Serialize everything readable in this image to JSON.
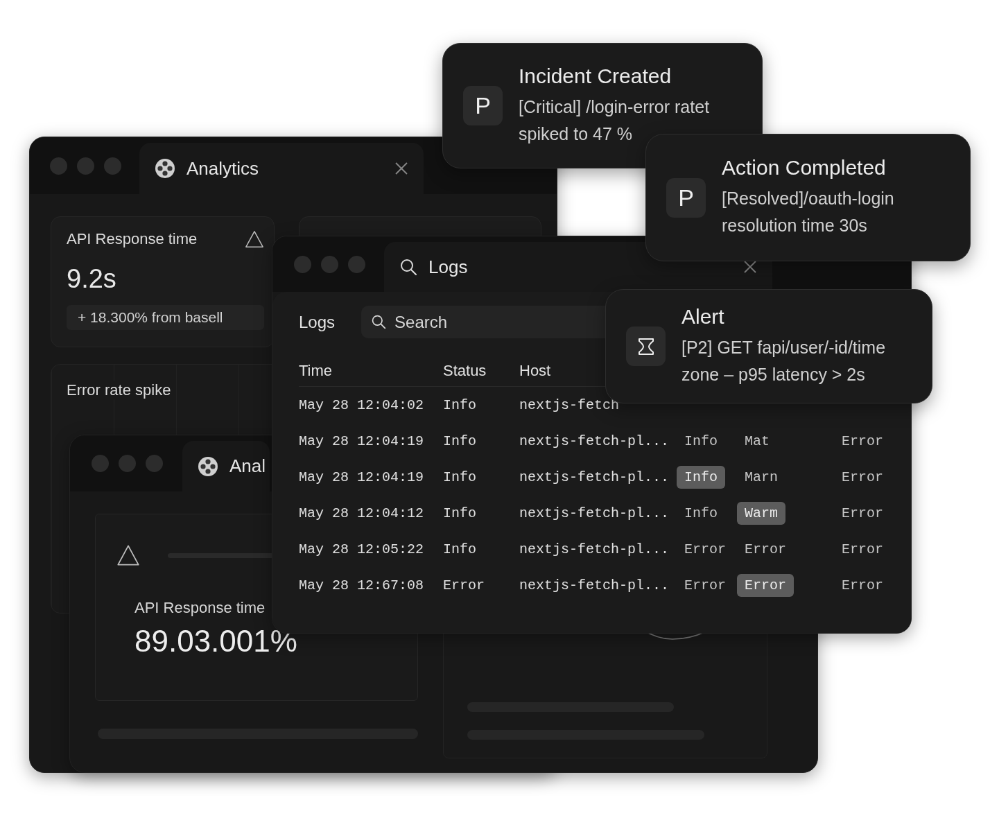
{
  "analytics_window": {
    "tab": {
      "title": "Analytics"
    },
    "metric_card": {
      "title": "API Response time",
      "value": "9.2s",
      "delta": "+ 18.300% from basell"
    },
    "chart_card": {
      "title": "Error rate spike"
    }
  },
  "inner_window": {
    "tab": {
      "title": "Anal"
    },
    "metric_card": {
      "title": "API Response time",
      "value": "89.03.001%"
    }
  },
  "logs_window": {
    "tab": {
      "title": "Logs"
    },
    "heading": "Logs",
    "search": {
      "placeholder": "Search"
    },
    "columns": [
      "Time",
      "Status",
      "Host"
    ],
    "rows": [
      {
        "time": "May 28 12:04:02",
        "status": "Info",
        "host": "nextjs-fetch",
        "cells": []
      },
      {
        "time": "May 28 12:04:19",
        "status": "Info",
        "host": "nextjs-fetch-pl...",
        "cells": [
          {
            "text": "Info",
            "highlighted": false
          },
          {
            "text": "Mat",
            "highlighted": false
          },
          {
            "text": "Error",
            "highlighted": false
          }
        ]
      },
      {
        "time": "May 28 12:04:19",
        "status": "Info",
        "host": "nextjs-fetch-pl...",
        "cells": [
          {
            "text": "Info",
            "highlighted": true
          },
          {
            "text": "Marn",
            "highlighted": false
          },
          {
            "text": "Error",
            "highlighted": false
          }
        ]
      },
      {
        "time": "May 28 12:04:12",
        "status": "Info",
        "host": "nextjs-fetch-pl...",
        "cells": [
          {
            "text": "Info",
            "highlighted": false
          },
          {
            "text": "Warm",
            "highlighted": true
          },
          {
            "text": "Error",
            "highlighted": false
          }
        ]
      },
      {
        "time": "May 28 12:05:22",
        "status": "Info",
        "host": "nextjs-fetch-pl...",
        "cells": [
          {
            "text": "Error",
            "highlighted": false
          },
          {
            "text": "Error",
            "highlighted": false
          },
          {
            "text": "Error",
            "highlighted": false
          }
        ]
      },
      {
        "time": "May 28 12:67:08",
        "status": "Error",
        "host": "nextjs-fetch-pl...",
        "cells": [
          {
            "text": "Error",
            "highlighted": false
          },
          {
            "text": "Error",
            "highlighted": true
          },
          {
            "text": "Error",
            "highlighted": false
          }
        ]
      }
    ]
  },
  "notifications": [
    {
      "kind": "letter",
      "badge": "P",
      "title": "Incident Created",
      "message": "[Critical] /login-error ratet spiked to 47 %"
    },
    {
      "kind": "letter",
      "badge": "P",
      "title": "Action Completed",
      "message": "[Resolved]/oauth-login resolution time 30s"
    },
    {
      "kind": "hourglass",
      "title": "Alert",
      "message": "[P2] GET fapi/user/-id/time zone – p95 latency > 2s"
    }
  ]
}
